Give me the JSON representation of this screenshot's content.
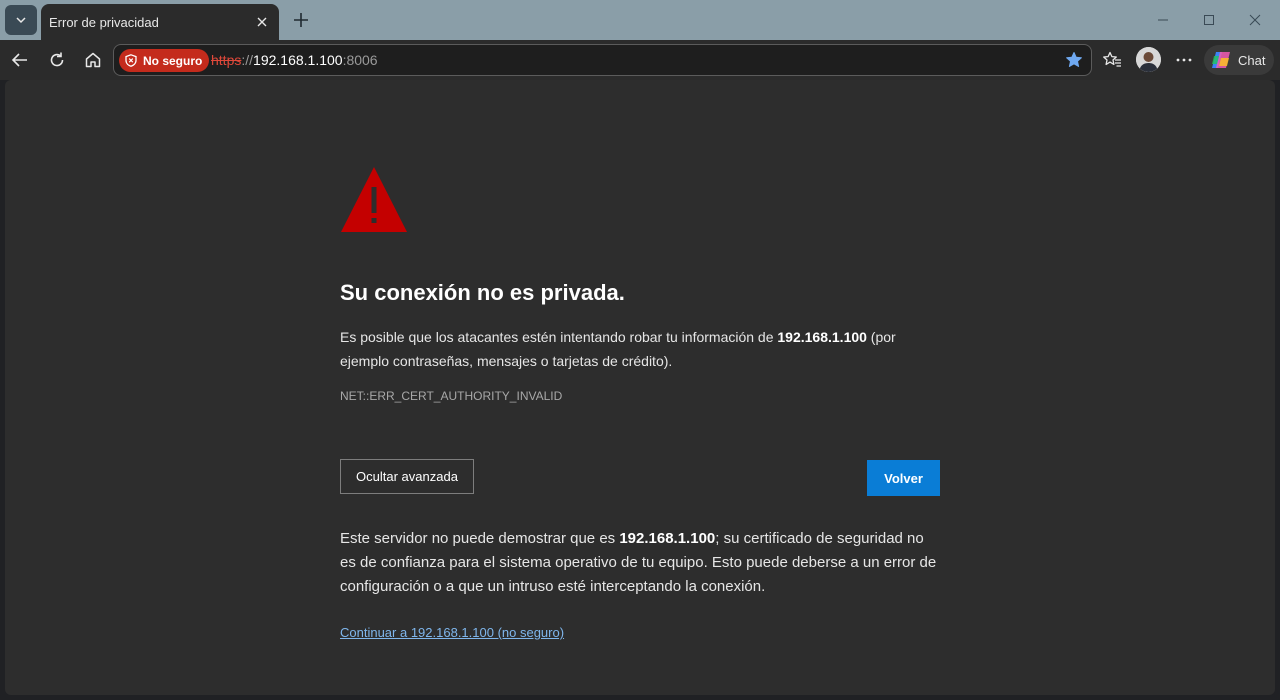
{
  "tab": {
    "title": "Error de privacidad"
  },
  "address_bar": {
    "security_chip_label": "No seguro",
    "scheme": "https",
    "separator": "://",
    "host": "192.168.1.100",
    "port": ":8006"
  },
  "toolbar": {
    "chat_label": "Chat"
  },
  "error_page": {
    "heading": "Su conexión no es privada.",
    "description_prefix": "Es posible que los atacantes estén intentando robar tu información de ",
    "description_host": "192.168.1.100",
    "description_suffix": " (por ejemplo contraseñas, mensajes o tarjetas de crédito).",
    "error_code": "NET::ERR_CERT_AUTHORITY_INVALID",
    "advanced_button": "Ocultar avanzada",
    "back_button": "Volver",
    "details_prefix": "Este servidor no puede demostrar que es ",
    "details_host": "192.168.1.100",
    "details_suffix": "; su certificado de seguridad no es de confianza para el sistema operativo de tu equipo. Esto puede deberse a un error de configuración o a que un intruso esté interceptando la conexión.",
    "proceed_link": "Continuar a 192.168.1.100 (no seguro)"
  },
  "colors": {
    "titlebar": "#8a9ea8",
    "warning_red": "#c42b1c",
    "primary_blue": "#0a7dd6",
    "link_blue": "#7fb6ec",
    "page_background": "#2d2d2d"
  },
  "icons": {
    "tab_actions": "chevron-down-icon",
    "close": "close-icon",
    "new_tab": "plus-icon",
    "back": "back-arrow-icon",
    "reload": "reload-icon",
    "home": "home-icon",
    "security": "shield-warning-icon",
    "favorite": "star-icon",
    "favorites": "favorites-list-icon",
    "more": "more-icon",
    "copilot": "copilot-icon",
    "warning": "warning-triangle-icon"
  }
}
